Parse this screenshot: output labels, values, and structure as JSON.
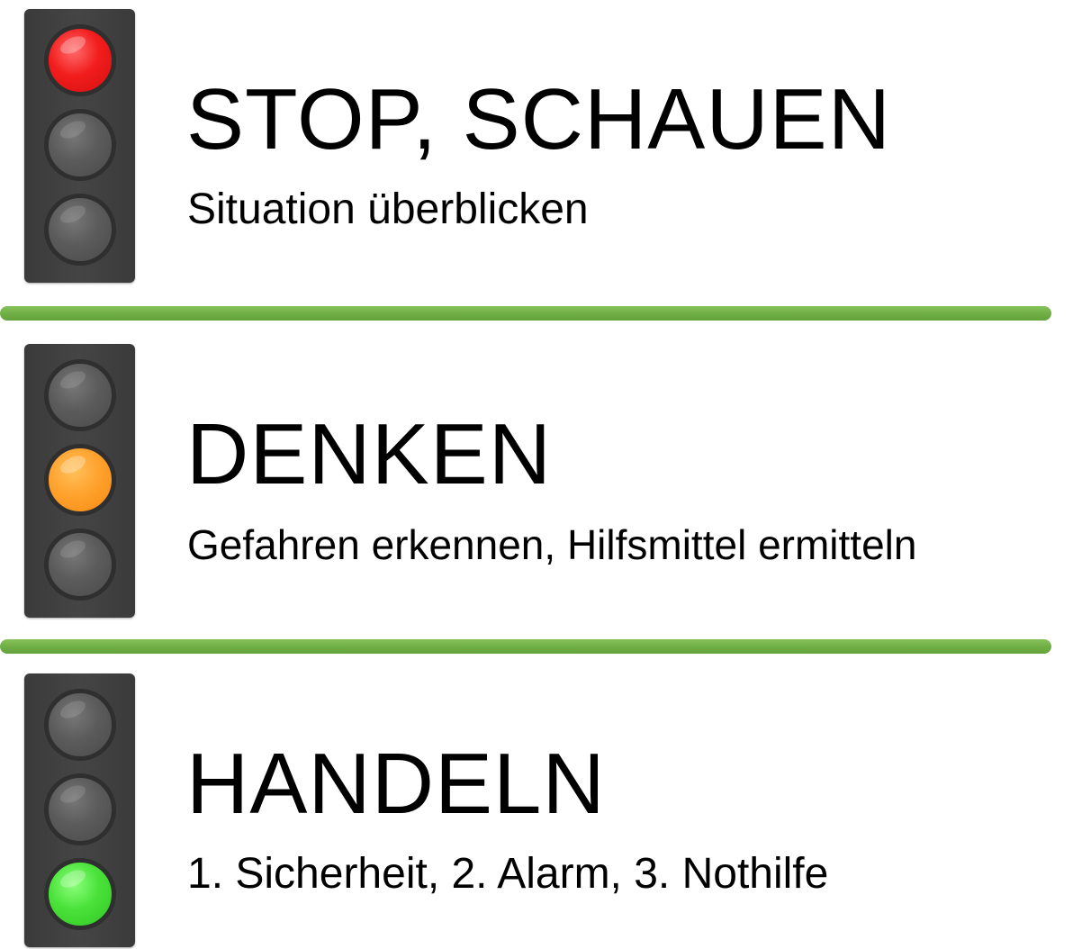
{
  "steps": [
    {
      "title": "STOP, SCHAUEN",
      "subtitle": "Situation überblicken",
      "active_lamp": "red",
      "icon": "traffic-light-red-icon"
    },
    {
      "title": "DENKEN",
      "subtitle": "Gefahren erkennen, Hilfsmittel ermitteln",
      "active_lamp": "amber",
      "icon": "traffic-light-amber-icon"
    },
    {
      "title": "HANDELN",
      "subtitle": "1. Sicherheit, 2. Alarm, 3. Nothilfe",
      "active_lamp": "green",
      "icon": "traffic-light-green-icon"
    }
  ],
  "colors": {
    "red": "#f21d1d",
    "amber": "#ffa22e",
    "green": "#4ae23a",
    "lamp_off": "#5b5b5b",
    "housing": "#404040",
    "divider": "#6fae44",
    "text": "#000000"
  }
}
